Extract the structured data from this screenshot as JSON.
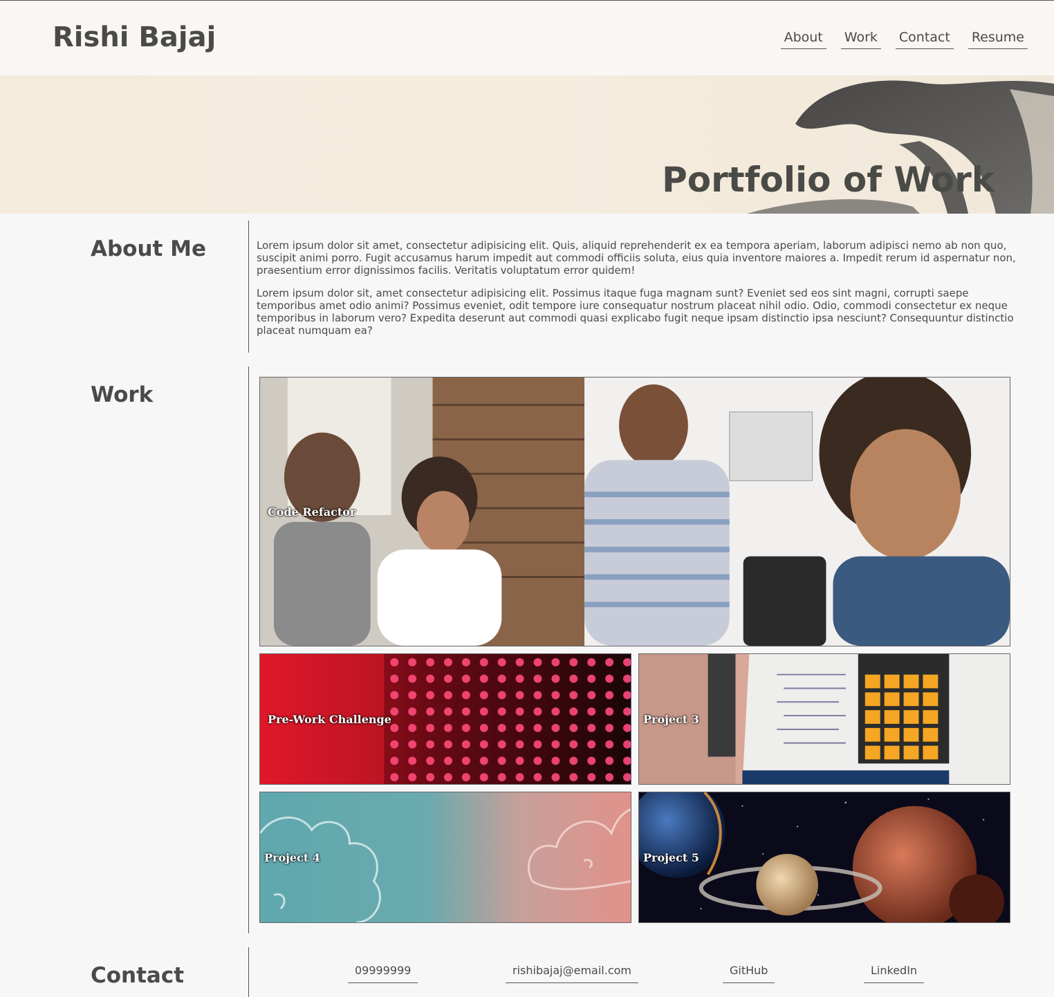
{
  "header": {
    "brand": "Rishi Bajaj",
    "nav": [
      "About",
      "Work",
      "Contact",
      "Resume"
    ]
  },
  "hero": {
    "title": "Portfolio of Work"
  },
  "about": {
    "heading": "About Me",
    "paragraphs": [
      "Lorem ipsum dolor sit amet, consectetur adipisicing elit. Quis, aliquid reprehenderit ex ea tempora aperiam, laborum adipisci nemo ab non quo, suscipit animi porro. Fugit accusamus harum impedit aut commodi officiis soluta, eius quia inventore maiores a. Impedit rerum id aspernatur non, praesentium error dignissimos facilis. Veritatis voluptatum error quidem!",
      "Lorem ipsum dolor sit, amet consectetur adipisicing elit. Possimus itaque fuga magnam sunt? Eveniet sed eos sint magni, corrupti saepe temporibus amet odio animi? Possimus eveniet, odit tempore iure consequatur nostrum placeat nihil odio. Odio, commodi consectetur ex neque temporibus in laborum vero? Expedita deserunt aut commodi quasi explicabo fugit neque ipsam distinctio ipsa nesciunt? Consequuntur distinctio placeat numquam ea?"
    ]
  },
  "work": {
    "heading": "Work",
    "projects": [
      "Code Refactor",
      "Pre-Work Challenge",
      "Project 3",
      "Project 4",
      "Project 5"
    ]
  },
  "contact": {
    "heading": "Contact",
    "links": [
      "09999999",
      "rishibajaj@email.com",
      "GitHub",
      "LinkedIn"
    ]
  },
  "colors": {
    "text": "#4a4a48",
    "background": "#f7f7f7",
    "header_bg": "#f9f6f3",
    "hero_bg": "#f4ebdd"
  }
}
